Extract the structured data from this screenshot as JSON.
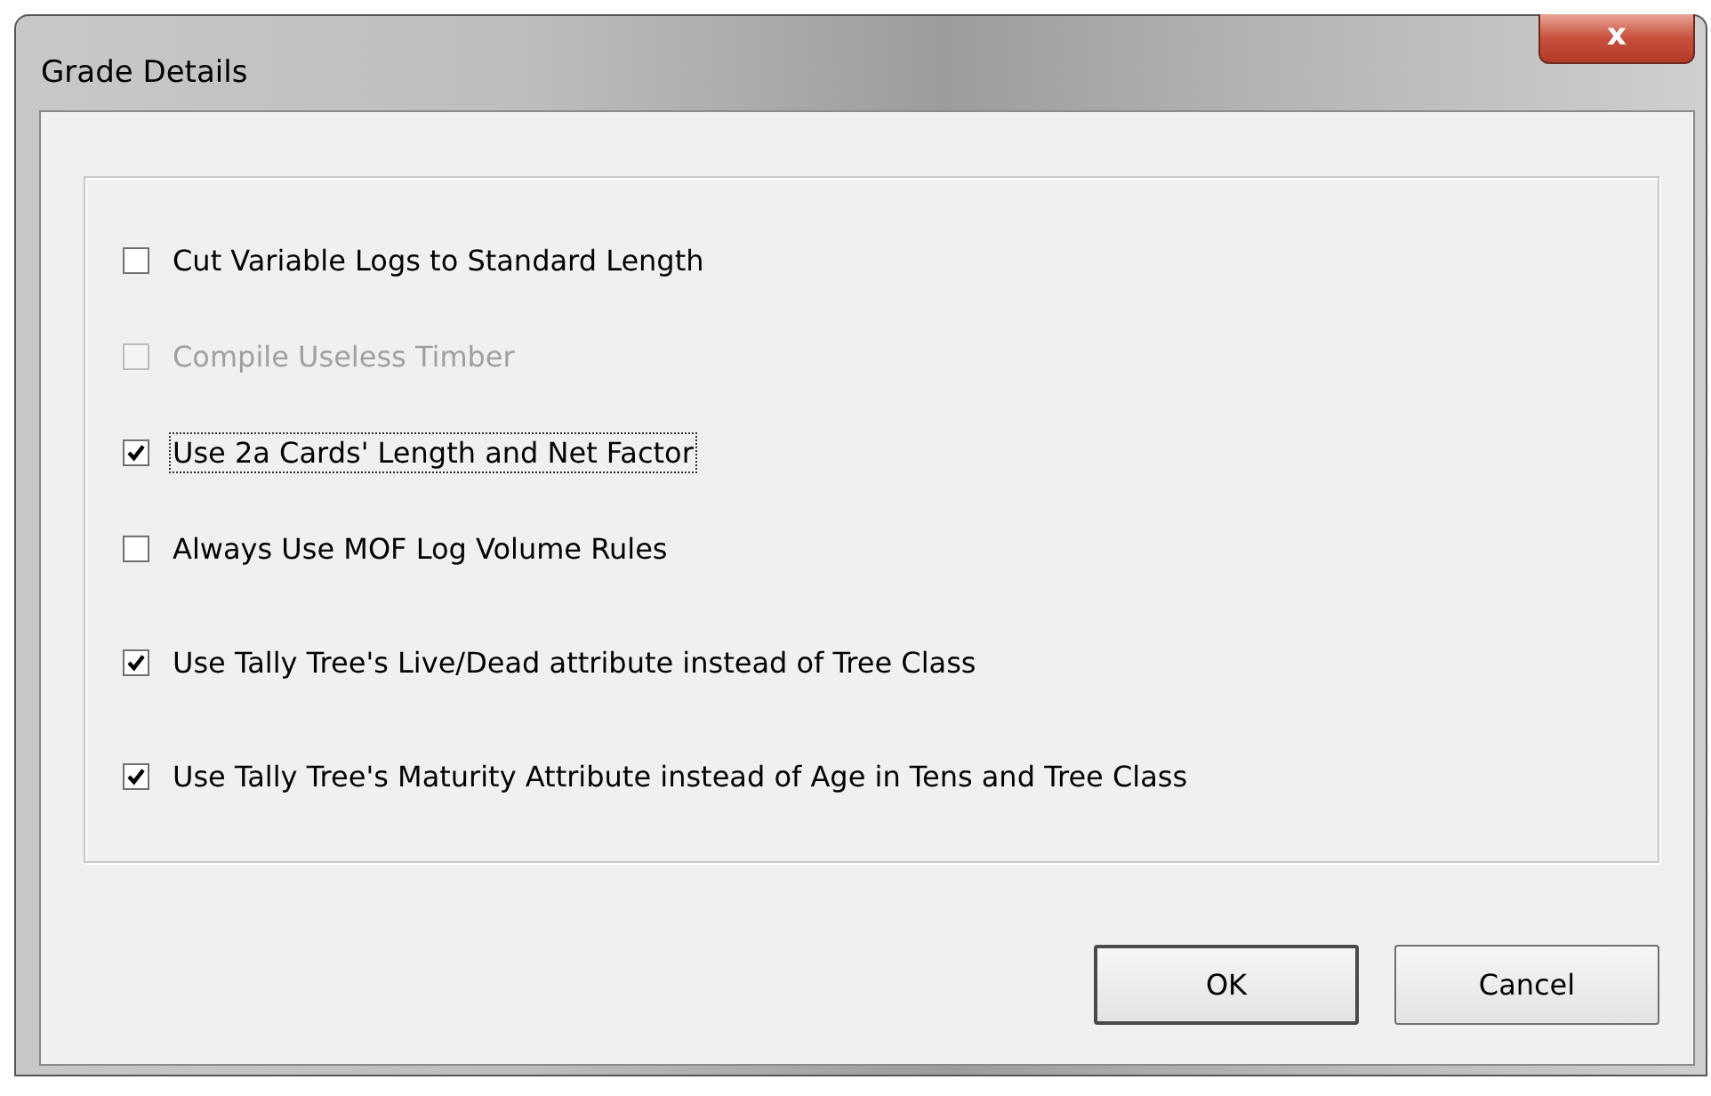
{
  "window": {
    "title": "Grade Details",
    "close_label": "x"
  },
  "options": [
    {
      "label": "Cut Variable Logs to Standard Length",
      "checked": false,
      "disabled": false,
      "focused": false
    },
    {
      "label": "Compile Useless Timber",
      "checked": false,
      "disabled": true,
      "focused": false
    },
    {
      "label": "Use 2a Cards' Length and Net Factor",
      "checked": true,
      "disabled": false,
      "focused": true
    },
    {
      "label": "Always Use MOF Log Volume Rules",
      "checked": false,
      "disabled": false,
      "focused": false
    },
    {
      "label": "Use Tally Tree's Live/Dead attribute instead of Tree Class",
      "checked": true,
      "disabled": false,
      "focused": false
    },
    {
      "label": "Use Tally Tree's Maturity Attribute instead of Age in Tens and Tree Class",
      "checked": true,
      "disabled": false,
      "focused": false
    }
  ],
  "buttons": [
    {
      "label": "OK",
      "default": true
    },
    {
      "label": "Cancel",
      "default": false
    }
  ]
}
